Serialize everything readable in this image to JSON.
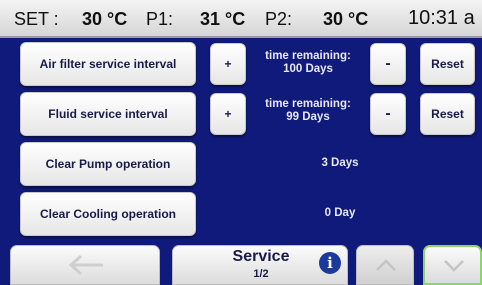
{
  "status": {
    "set_label": "SET :",
    "set_value": "30 °C",
    "p1_label": "P1:",
    "p1_value": "31 °C",
    "p2_label": "P2:",
    "p2_value": "30 °C",
    "clock": "10:31 a"
  },
  "rows": [
    {
      "label": "Air filter service interval",
      "plus": "+",
      "info_line1": "time remaining:",
      "info_line2": "100 Days",
      "minus": "-",
      "reset": "Reset"
    },
    {
      "label": "Fluid service interval",
      "plus": "+",
      "info_line1": "time remaining:",
      "info_line2": "99 Days",
      "minus": "-",
      "reset": "Reset"
    },
    {
      "label": "Clear Pump operation",
      "info": "3 Days"
    },
    {
      "label": "Clear Cooling operation",
      "info": "0 Day"
    }
  ],
  "nav": {
    "title": "Service",
    "page": "1/2",
    "info_glyph": "i",
    "back_icon": "arrow-left-icon",
    "up_icon": "chevron-up-icon",
    "down_icon": "chevron-down-icon",
    "accent_color": "#8fd46a"
  }
}
